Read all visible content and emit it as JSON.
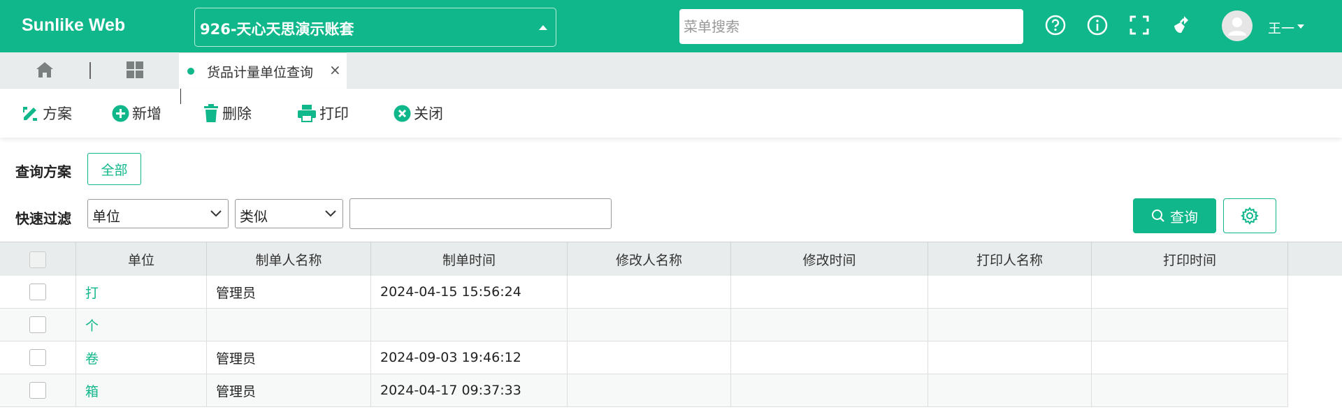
{
  "app": {
    "brand": "Sunlike Web",
    "account": "926-天心天思演示账套"
  },
  "search": {
    "placeholder": "菜单搜索"
  },
  "header_icons": [
    "help-icon",
    "info-icon",
    "fullscreen-icon",
    "clear-cache-icon"
  ],
  "user": {
    "name": "王一"
  },
  "tabs": [
    {
      "label": "货品计量单位查询",
      "close": "×"
    }
  ],
  "toolbar": {
    "scheme": "方案",
    "add": "新增",
    "delete": "删除",
    "print": "打印",
    "close": "关闭"
  },
  "filter": {
    "scheme_label": "查询方案",
    "scheme_all": "全部",
    "quick_label": "快速过滤",
    "field_value": "单位",
    "operator_value": "类似",
    "value": "",
    "query_label": "查询"
  },
  "table": {
    "columns": [
      "单位",
      "制单人名称",
      "制单时间",
      "修改人名称",
      "修改时间",
      "打印人名称",
      "打印时间"
    ],
    "rows": [
      {
        "unit": "打",
        "creator": "管理员",
        "created": "2024-04-15 15:56:24",
        "modifier": "",
        "modified": "",
        "printer": "",
        "printed": ""
      },
      {
        "unit": "个",
        "creator": "",
        "created": "",
        "modifier": "",
        "modified": "",
        "printer": "",
        "printed": ""
      },
      {
        "unit": "卷",
        "creator": "管理员",
        "created": "2024-09-03 19:46:12",
        "modifier": "",
        "modified": "",
        "printer": "",
        "printed": ""
      },
      {
        "unit": "箱",
        "creator": "管理员",
        "created": "2024-04-17 09:37:33",
        "modifier": "",
        "modified": "",
        "printer": "",
        "printed": ""
      }
    ]
  },
  "colors": {
    "primary": "#0fb78a",
    "tab_strip": "#e9ecec",
    "header_bg": "#e9ecec"
  }
}
